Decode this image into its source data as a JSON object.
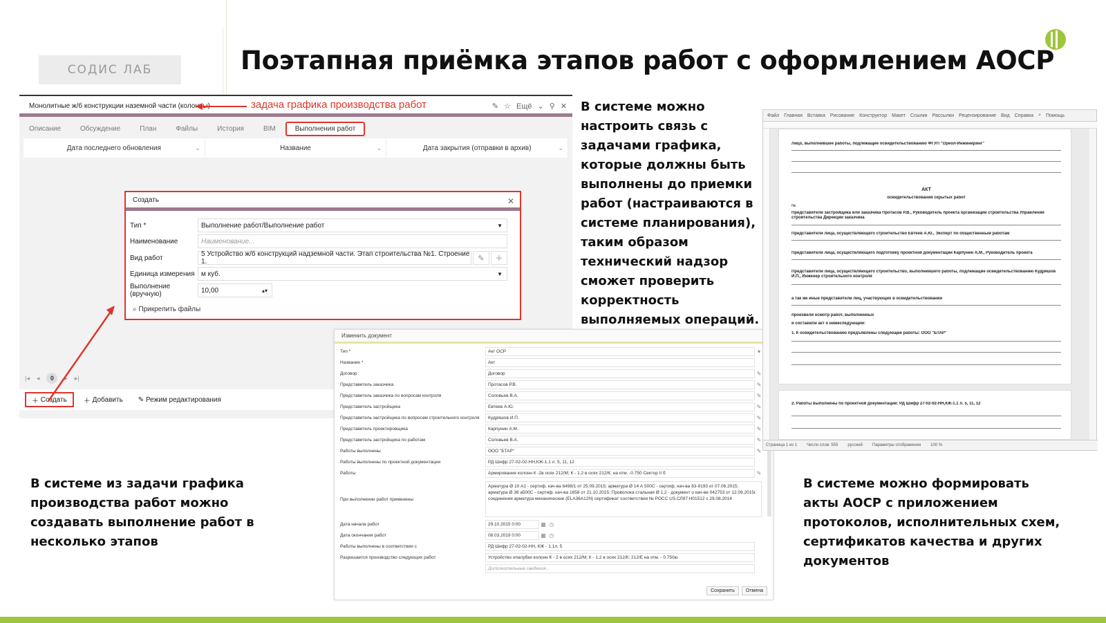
{
  "header": {
    "logo": "СОДИС ЛАБ",
    "title": "Поэтапная приёмка этапов работ с оформлением АОСР"
  },
  "captions": {
    "right": "В системе можно\nнастроить связь с\nзадачами графика,\nкоторые должны быть\nвыполнены до приемки\nработ (настраиваются в\nсистеме планирования),\nтаким образом\nтехнический надзор\nсможет проверить\nкорректность\nвыполняемых операций.",
    "left": "В системе из задачи графика\nпроизводства работ можно\nсоздавать выполнение работ в\nнесколько этапов",
    "bottom_right": "В системе можно формировать\nакты АОСР с приложением\nпротоколов, исполнительных схем,\nсертификатов качества и других\nдокументов"
  },
  "task": {
    "title": "Монолитные ж/б конструкции наземной части (колонны)",
    "note": "задача графика производства работ",
    "more": "Ещё",
    "tabs": [
      "Описание",
      "Обсуждение",
      "План",
      "Файлы",
      "История",
      "BIM"
    ],
    "active_tab": "Выполнения работ",
    "columns": [
      "Дата последнего обновления",
      "Название",
      "Дата закрытия (отправки в архив)"
    ],
    "page_number": "0",
    "toolbar": {
      "create": "Создать",
      "add": "Добавить",
      "edit_mode": "Режим редактирования"
    }
  },
  "dialog": {
    "title": "Создать",
    "type_label": "Тип *",
    "type_value": "Выполнение работ/Выполнение работ",
    "name_label": "Наименование",
    "name_placeholder": "Наименование...",
    "work_label": "Вид работ",
    "work_value": "5 Устройство ж/б конструкций надземной части. Этап строительства №1. Строение 1.",
    "unit_label": "Единица измерения",
    "unit_value": "м куб.",
    "manual_label": "Выполнение (вручную)",
    "manual_value": "10,00",
    "attach": "Прикрепить файлы"
  },
  "doc": {
    "title": "Изменить документ",
    "rows": [
      {
        "label": "Тип *",
        "value": "Акт ОСР"
      },
      {
        "label": "Название *",
        "value": "Акт"
      },
      {
        "label": "Договор",
        "value": "Договор"
      },
      {
        "label": "Представитель заказчика",
        "value": "Протасов Р.В."
      },
      {
        "label": "Представитель заказчика по вопросам контроля",
        "value": "Соловьев В.А."
      },
      {
        "label": "Представитель застройщика",
        "value": "Евтеев А.Ю."
      },
      {
        "label": "Представитель застройщика по вопросам строительного контроля",
        "value": "Кудряшов И.П."
      },
      {
        "label": "Представитель проектировщика",
        "value": "Карпунин А.М."
      },
      {
        "label": "Представитель застройщика по работам",
        "value": "Соловьев В.А."
      },
      {
        "label": "Работы выполнены",
        "value": "ООО \"БТАР\""
      },
      {
        "label": "Работы выполнены по проектной документации",
        "value": "РД Шифр 27-02-02-НН,КЖ-1.1 л. 5, 11, 12"
      },
      {
        "label": "Работы",
        "value": "Армирование колонн К -2в осях 212/М; К - 1.2 в осях 212/К; на отм. -0.750 Сектор II б"
      }
    ],
    "materials_label": "При выполнении работ применены",
    "materials_text": "Арматура Ø 10 А1 - сертиф. кач-ва 6498/1 от 25.09.2015; арматура Ø 14 А 500С - сертиф. кач-ва 83-9193 от 07.06.2015; арматура Ø 36 а500С - сертиф. кач-ва 1658 от 21.10.2015; Проволока стальная Ø 1,2 - документ о кач-ве 042753 от 12.09.2015г. соединения арматура механические (ELA36A12N) сертификат соответствия № РОСС US.СЛ87.Н01512 с 29.08.2014",
    "rows2": [
      {
        "label": "Дата начала работ",
        "value": "29.10.2015 0:00"
      },
      {
        "label": "Дата окончания работ",
        "value": "08.03.2019 0:00"
      },
      {
        "label": "Работы выполнены в соответствии с",
        "value": "РД Шифр 27-02-02-НН, КЖ - 1.1л. 5"
      },
      {
        "label": "Разрешается производство следующих работ",
        "value": "Устройство опалубки колонн К - 2 в осях 212/М; К - 1.2 в осях 212/К; 212/Е на отм. - 0.750ю"
      }
    ],
    "extra_placeholder": "Дополнительные сведения...",
    "save": "Сохранить",
    "cancel": "Отмена"
  },
  "word": {
    "ribbon": [
      "Файл",
      "Главная",
      "Вставка",
      "Рисование",
      "Конструктор",
      "Макет",
      "Ссылки",
      "Рассылки",
      "Рецензирование",
      "Вид",
      "Справка",
      "Помощь"
    ],
    "lines": {
      "l1": "Лицо, выполнившее работы, подлежащие освидетельствованию ФГУП \"Ореол-Инжиниринг\"",
      "act": "АКТ",
      "act_sub": "освидетельствования скрытых работ",
      "num": "№",
      "l2": "Представители застройщика или заказчика      Протасов Р.В., Руководитель проекта организации строительства Управления строительства Дирекции заказчика",
      "l3": "Представители лица, осуществляющего строительство   Евтеев А.Ю., Эксперт по общественным работам",
      "l4": "Представители лица, осуществляющего подготовку проектной документации   Карпунин А.М., Руководитель проекта",
      "l5": "Представители лица, осуществляющего строительство, выполнившего работы, подлежащие освидетельствованию Кудряшов И.П., Инженер строительного контроля",
      "l6": "а так же иные представители лиц, участвующих в освидетельствовании",
      "l7": "произвели осмотр работ, выполненных",
      "l8": "и составили акт о нижеследующем:",
      "l9": "1. К освидетельствованию предъявлены следующие работы: ООО \"БТАР\"",
      "l10": "2. Работы выполнены по проектной документации: РД Шифр 27-02-02-НН,КЖ-1.1 л. 5, 11, 12"
    },
    "status": [
      "Страница 1 из 1",
      "Число слов: 555",
      "русский",
      "Параметры отображения",
      "100 %"
    ]
  }
}
